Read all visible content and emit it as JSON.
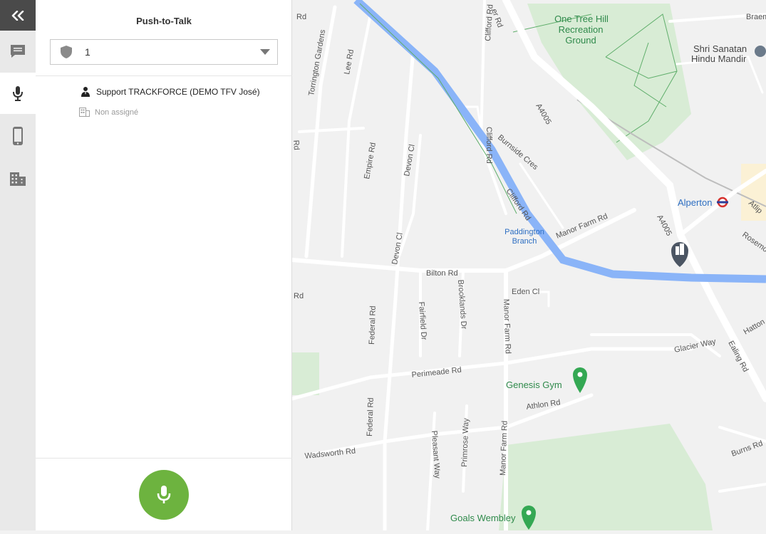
{
  "panel": {
    "title": "Push-to-Talk",
    "group_value": "1",
    "member_name": "Support TRACKFORCE (DEMO TFV José)",
    "member_assignment": "Non assigné"
  },
  "rail": {
    "items": [
      "collapse-icon",
      "chat-icon",
      "microphone-icon",
      "phone-icon",
      "building-icon"
    ],
    "active": "microphone-icon"
  },
  "colors": {
    "ptt_button": "#6db33f",
    "canal": "#8ab4f8",
    "park": "#d8ecd5",
    "road": "#ffffff"
  },
  "map": {
    "parks": {
      "one_tree_hill": "One Tree Hill",
      "recreation": "Recreation",
      "ground": "Ground"
    },
    "poi": {
      "mandir_1": "Shri Sanatan",
      "mandir_2": "Hindu Mandir",
      "alperton": "Alperton",
      "genesis_gym": "Genesis Gym",
      "goals_wembley": "Goals Wembley",
      "paddington": "Paddington",
      "branch": "Branch"
    },
    "streets": {
      "er_rd": "er Rd",
      "braemar": "Braem",
      "rd_top": "Rd",
      "torrington": "Torrington Gardens",
      "lee_rd": "Lee Rd",
      "clifford_rd_1": "Clifford Rd",
      "a4005_1": "A4005",
      "burnside": "Burnside Cres",
      "clifford_rd_2": "Clifford Rd",
      "clifford_rd_3": "Clifford Rd",
      "empire_rd": "Empire Rd",
      "devon_cl_1": "Devon Cl",
      "devon_cl_2": "Devon Cl",
      "a4005_2": "A4005",
      "manor_farm_rd_1": "Manor Farm Rd",
      "atlip": "Atlip",
      "rosemont": "Rosemo",
      "bilton_rd": "Bilton Rd",
      "eden_cl": "Eden Cl",
      "rd_left": "Rd",
      "federal_rd_1": "Federal Rd",
      "fairfield_dr": "Fairfield Dr",
      "brooklands_dr": "Brooklands Dr",
      "manor_farm_rd_2": "Manor Farm Rd",
      "glacier_way": "Glacier Way",
      "ealing_rd": "Ealing Rd",
      "hatton": "Hatton",
      "perimeade_rd": "Perimeade Rd",
      "athlon_rd": "Athlon Rd",
      "federal_rd_2": "Federal Rd",
      "wadsworth_rd": "Wadsworth Rd",
      "pleasant_way": "Pleasant Way",
      "primrose_way": "Primrose Way",
      "manor_farm_rd_3": "Manor Farm Rd",
      "burns_rd": "Burns Rd",
      "rd_leftedge": "Rd"
    }
  }
}
